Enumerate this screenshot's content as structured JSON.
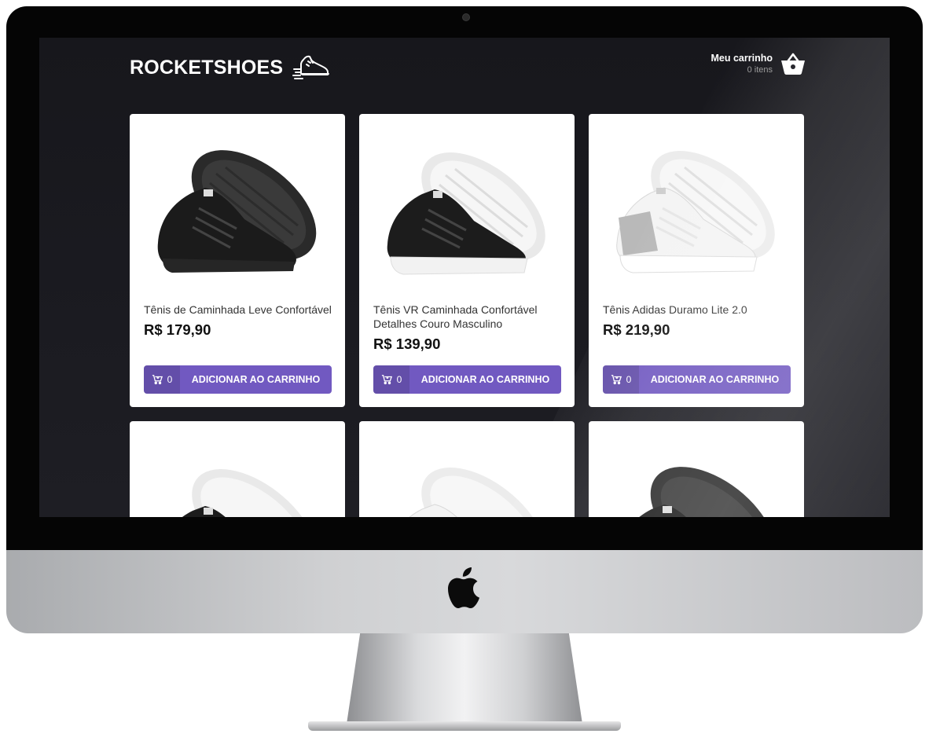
{
  "brand": {
    "name": "ROCKETSHOES",
    "icon": "running-shoe-icon"
  },
  "cart": {
    "title": "Meu carrinho",
    "count_text": "0 itens",
    "icon": "basket-icon"
  },
  "products": [
    {
      "name": "Tênis de Caminhada Leve Confortável",
      "price": "R$ 179,90",
      "qty": "0",
      "button": "ADICIONAR AO CARRINHO",
      "variant": "black"
    },
    {
      "name": "Tênis VR Caminhada Confortável Detalhes Couro Masculino",
      "price": "R$ 139,90",
      "qty": "0",
      "button": "ADICIONAR AO CARRINHO",
      "variant": "black-white"
    },
    {
      "name": "Tênis Adidas Duramo Lite 2.0",
      "price": "R$ 219,90",
      "qty": "0",
      "button": "ADICIONAR AO CARRINHO",
      "variant": "white-grey"
    },
    {
      "variant": "black-white"
    },
    {
      "variant": "white-grey"
    },
    {
      "variant": "black"
    }
  ],
  "colors": {
    "primary": "#7159c1",
    "background": "#191920",
    "card": "#ffffff"
  }
}
